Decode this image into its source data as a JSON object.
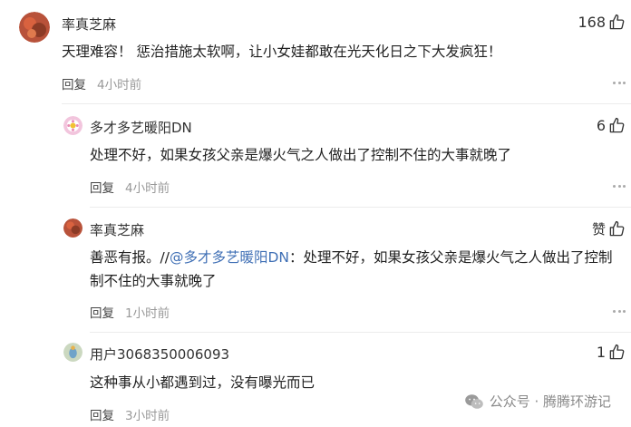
{
  "comments": [
    {
      "username": "率真芝麻",
      "likes": "168",
      "text": "天理难容！ 惩治措施太软啊，让小女娃都敢在光天化日之下大发疯狂！",
      "reply_label": "回复",
      "time": "4小时前"
    },
    {
      "username": "多才多艺暖阳DN",
      "likes": "6",
      "text": "处理不好，如果女孩父亲是爆火气之人做出了控制不住的大事就晚了",
      "reply_label": "回复",
      "time": "4小时前"
    },
    {
      "username": "率真芝麻",
      "likes": "赞",
      "text_prefix": "善恶有报。//",
      "mention": "@多才多艺暖阳DN",
      "text_line1_rest": "：处理不好，如果女孩父亲是爆火气之人做出了控制",
      "text_line2": "制不住的大事就晚了",
      "reply_label": "回复",
      "time": "1小时前"
    },
    {
      "username": "用户3068350006093",
      "likes": "1",
      "text": "这种事从小都遇到过，没有曝光而已",
      "reply_label": "回复",
      "time": "3小时前"
    }
  ],
  "watermark": "公众号 · 腾腾环游记",
  "icons": {
    "like": "thumbs-up-icon",
    "more": "more-dots-icon",
    "watermark": "wechat-icon"
  }
}
